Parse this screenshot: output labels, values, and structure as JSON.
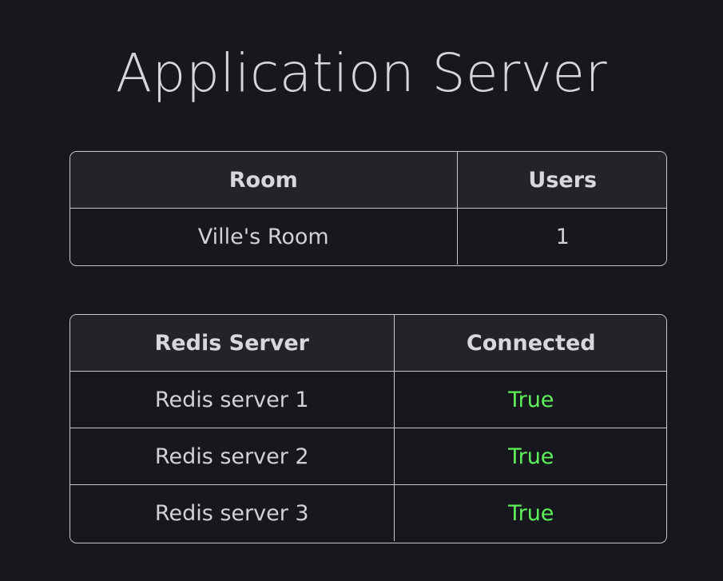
{
  "page": {
    "title": "Application Server"
  },
  "rooms_table": {
    "headers": [
      "Room",
      "Users"
    ],
    "rows": [
      {
        "room": "Ville's Room",
        "users": "1"
      }
    ]
  },
  "redis_table": {
    "headers": [
      "Redis Server",
      "Connected"
    ],
    "rows": [
      {
        "server": "Redis server 1",
        "connected": "True"
      },
      {
        "server": "Redis server 2",
        "connected": "True"
      },
      {
        "server": "Redis server 3",
        "connected": "True"
      }
    ]
  },
  "colors": {
    "background": "#16181e",
    "header_bg": "#232428",
    "border": "#c8c8cc",
    "status_true": "#5ef05a"
  }
}
